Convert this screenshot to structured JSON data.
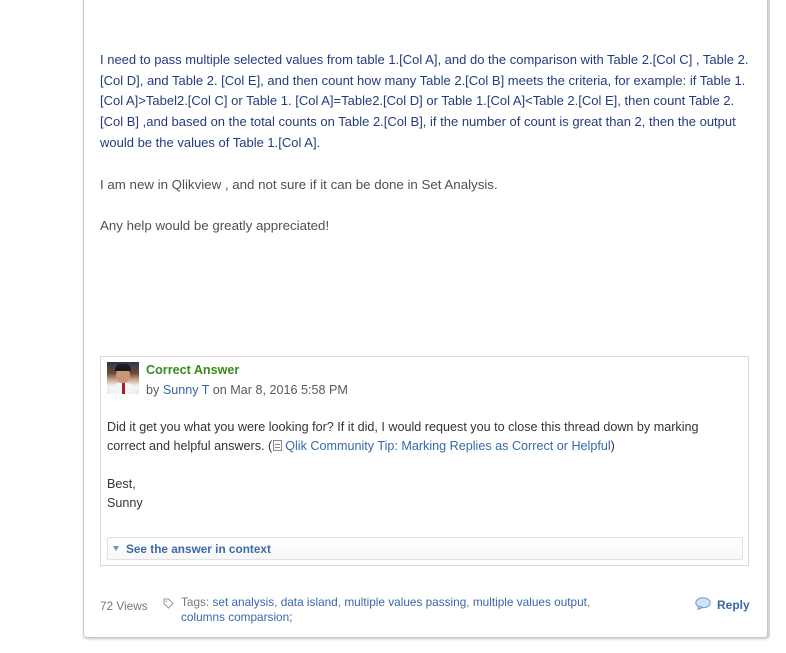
{
  "post": {
    "question": "I need to pass multiple selected values from table 1.[Col A], and do the comparison with Table 2.[Col C] ,  Table 2. [Col D],  and Table 2. [Col E],  and then count how many Table 2.[Col B] meets the criteria, for example: if Table 1. [Col A]>Tabel2.[Col C] or Table 1. [Col A]=Table2.[Col D] or Table 1.[Col A]<Table 2.[Col E], then count Table 2.[Col B] ,and based on the total counts on Table 2.[Col B], if the number of count is great than 2,  then the output would be the values of Table 1.[Col A].",
    "paragraph2": "I am new in Qlikview , and not sure if it can be done in Set Analysis.",
    "paragraph3": "Any help would be greatly appreciated!"
  },
  "answer": {
    "title": "Correct Answer",
    "by": "by",
    "author": "Sunny T",
    "date": "on Mar 8, 2016 5:58 PM",
    "text_before_link": "Did it get you what you were looking for? If it did, I would request you to close this thread down by marking correct and helpful answers. (",
    "link_text": "Qlik Community Tip: Marking Replies as Correct or Helpful",
    "text_after_link": ")",
    "signoff_1": "Best,",
    "signoff_2": "Sunny",
    "context_label": "See the answer in context"
  },
  "footer": {
    "views": "72 Views",
    "tags_label": "Tags:",
    "tags": [
      "set analysis",
      "data island",
      "multiple values passing",
      "multiple values output",
      "columns comparsion;"
    ],
    "reply_label": "Reply"
  },
  "icons": {
    "avatar": "user-avatar",
    "tag": "tag-icon",
    "reply": "speech-bubble-icon",
    "doc": "document-icon",
    "expand": "triangle-down-icon"
  },
  "colors": {
    "link": "#3868a9",
    "question_text": "#233c7d",
    "correct_green": "#3a8a1f",
    "body_text": "#505050"
  }
}
